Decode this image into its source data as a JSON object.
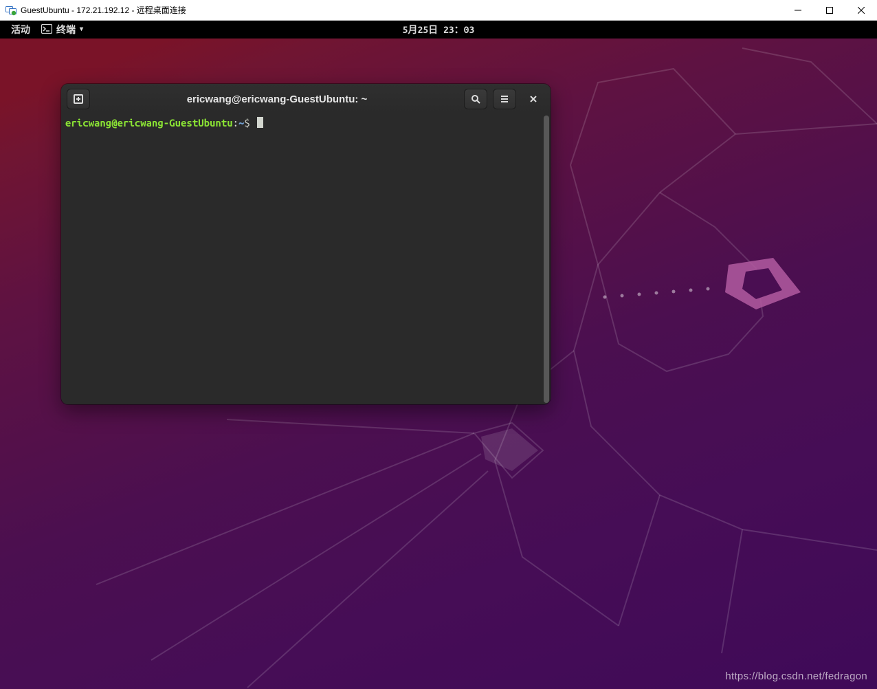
{
  "rdp": {
    "title": "GuestUbuntu - 172.21.192.12 - 远程桌面连接"
  },
  "gnome": {
    "activities": "活动",
    "app_menu_label": "终端",
    "clock": "5月25日 23：03"
  },
  "terminal": {
    "window_title": "ericwang@ericwang-GuestUbuntu: ~",
    "prompt_user": "ericwang@ericwang-GuestUbuntu",
    "prompt_cwd": "~",
    "prompt_symbol": "$",
    "icon_new_tab": "new-tab-icon",
    "icon_search": "search-icon",
    "icon_menu": "hamburger-icon",
    "icon_close": "close-icon"
  },
  "watermark": "https://blog.csdn.net/fedragon"
}
